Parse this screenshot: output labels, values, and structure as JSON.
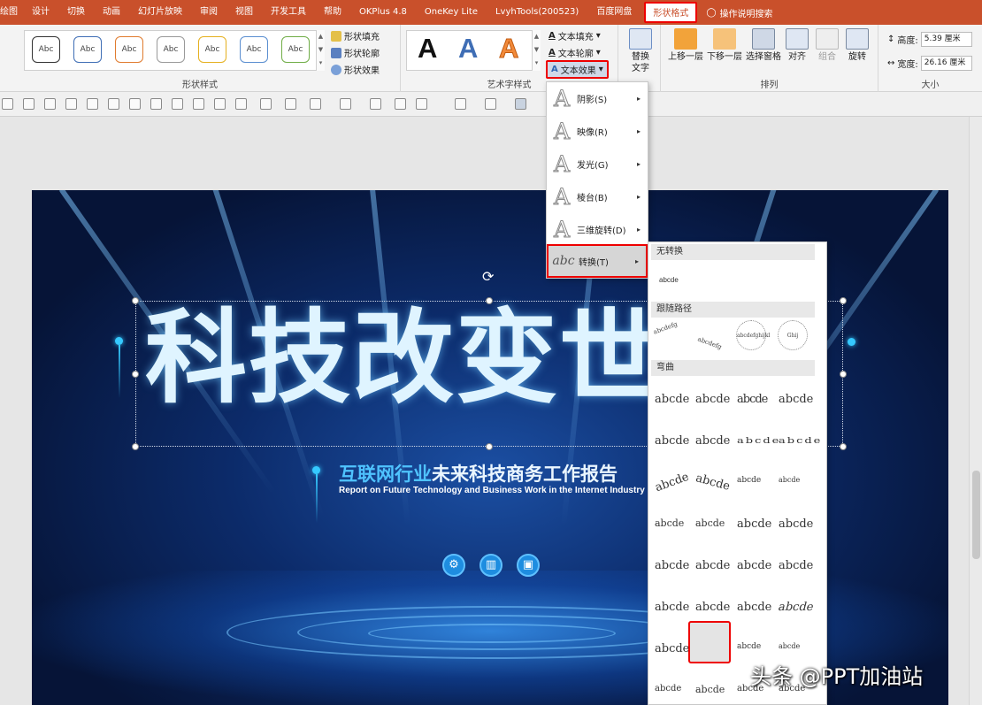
{
  "tabs": [
    "绘图",
    "设计",
    "切换",
    "动画",
    "幻灯片放映",
    "审阅",
    "视图",
    "开发工具",
    "帮助",
    "OKPlus 4.8",
    "OneKey Lite",
    "LvyhTools(200523)",
    "百度网盘",
    "形状格式"
  ],
  "tell_me": "操作说明搜索",
  "ribbon": {
    "shape_styles": {
      "sample": "Abc",
      "label": "形状样式",
      "fill": "形状填充",
      "outline": "形状轮廓",
      "effects": "形状效果"
    },
    "wordart": {
      "sample": "A",
      "label": "艺术字样式",
      "text_fill": "文本填充",
      "text_outline": "文本轮廓",
      "text_effects": "文本效果"
    },
    "replace_text": "替换\n文字",
    "arrange": {
      "label": "排列",
      "bring_forward": "上移一层",
      "send_backward": "下移一层",
      "selection_pane": "选择窗格",
      "align": "对齐",
      "group": "组合",
      "rotate": "旋转"
    },
    "size": {
      "label": "大小",
      "height_label": "高度:",
      "height": "5.39 厘米",
      "width_label": "宽度:",
      "width": "26.16 厘米"
    }
  },
  "slide": {
    "title": "科技改变世",
    "subtitle_hl": "互联网行业",
    "subtitle_rest": "未来科技商务工作报告",
    "subtitle_en": "Report on Future Technology and Business Work in the Internet Industry"
  },
  "text_effects_menu": [
    {
      "label": "阴影(S)",
      "glyph": "A"
    },
    {
      "label": "映像(R)",
      "glyph": "A"
    },
    {
      "label": "发光(G)",
      "glyph": "A"
    },
    {
      "label": "棱台(B)",
      "glyph": "A"
    },
    {
      "label": "三维旋转(D)",
      "glyph": "A"
    },
    {
      "label": "转换(T)",
      "glyph": "abc"
    }
  ],
  "transform_menu": {
    "no_transform": "无转换",
    "sample": "abcde",
    "follow_path": "跟随路径",
    "follow_samples": [
      "abcdefg",
      "abcdefg",
      "abcdefghijkl",
      "Ghij"
    ],
    "warp": "弯曲",
    "warp_samples": "abcde"
  },
  "watermark": "头条 @PPT加油站",
  "colors": {
    "tab_bar": "#c9502b",
    "highlight": "#e00000",
    "accent": "#35c9ff"
  }
}
